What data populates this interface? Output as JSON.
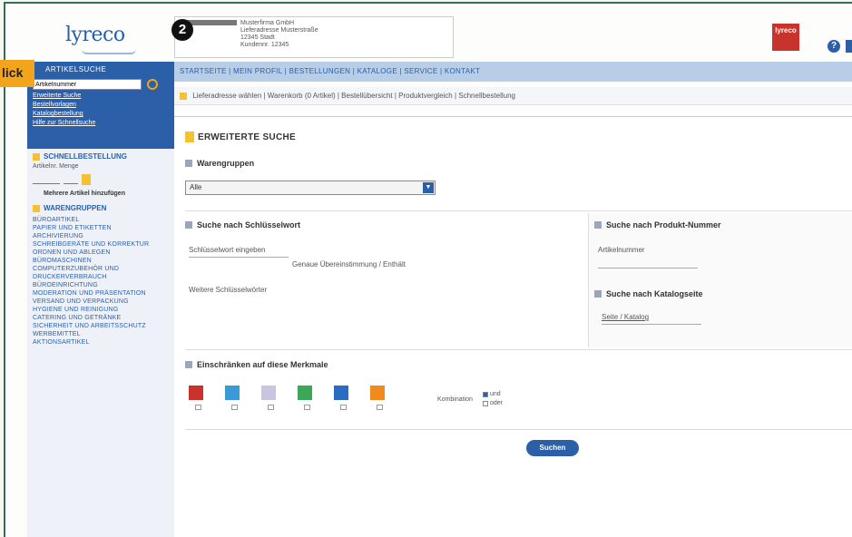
{
  "header": {
    "logo_text": "lyreco",
    "address_lines": [
      "Musterfirma GmbH",
      "Lieferadresse Musterstraße",
      "12345 Stadt",
      "Kundennr. 12345"
    ],
    "badge_label": "lyreco",
    "help_label": "?"
  },
  "callout": {
    "label": "lick",
    "step_number": "2"
  },
  "sidebar": {
    "search_title": "ARTIKELSUCHE",
    "search_value": "Artikelnummer",
    "links": [
      "Erweiterte Suche",
      "Bestellvorlagen",
      "Katalogbestellung",
      "Hilfe zur Schnellsuche"
    ],
    "quick_title": "SCHNELLBESTELLUNG",
    "quick_label": "Artikelnr. Menge",
    "quick_link": "Mehrere Artikel hinzufügen",
    "cat_title": "WARENGRUPPEN",
    "categories": [
      "Büroartikel",
      "Papier und Etiketten",
      "Archivierung",
      "Schreibgeräte und Korrektur",
      "Ordnen und Ablegen",
      "Büromaschinen",
      "Computerzubehör und Druckerverbrauch",
      "Büroeinrichtung",
      "Moderation und Präsentation",
      "Versand und Verpackung",
      "Hygiene und Reinigung",
      "Catering und Getränke",
      "Sicherheit und Arbeitsschutz",
      "Werbemittel",
      "Aktionsartikel"
    ]
  },
  "topnav": {
    "items": "STARTSEITE | MEIN PROFIL | BESTELLUNGEN | KATALOGE | SERVICE | KONTAKT"
  },
  "subnav": {
    "text": "Lieferadresse wählen   |   Warenkorb (0 Artikel)   |   Bestellübersicht   |   Produktvergleich   |   Schnellbestellung"
  },
  "main": {
    "title": "ERWEITERTE SUCHE",
    "section_warengruppe": "Warengruppen",
    "select_value": "Alle",
    "section_schluesselwort": "Suche nach Schlüsselwort",
    "field_keyword": "Schlüsselwort eingeben",
    "keyword_hint": "Genaue Übereinstimmung / Enthält",
    "field_keyword2": "Weitere Schlüsselwörter",
    "section_produktnr": "Suche nach Produkt-Nummer",
    "field_produktnr": "Artikelnummer",
    "section_katalog": "Suche nach Katalogseite",
    "field_katalog": "Seite / Katalog",
    "section_merkmale": "Einschränken auf diese Merkmale",
    "radio_label": "Kombination",
    "radio_options": [
      "und",
      "oder"
    ],
    "submit_label": "Suchen"
  },
  "colors": {
    "brand_blue": "#2b5fa8",
    "accent_yellow": "#f2c232",
    "nav_bg": "#b8cde6"
  }
}
